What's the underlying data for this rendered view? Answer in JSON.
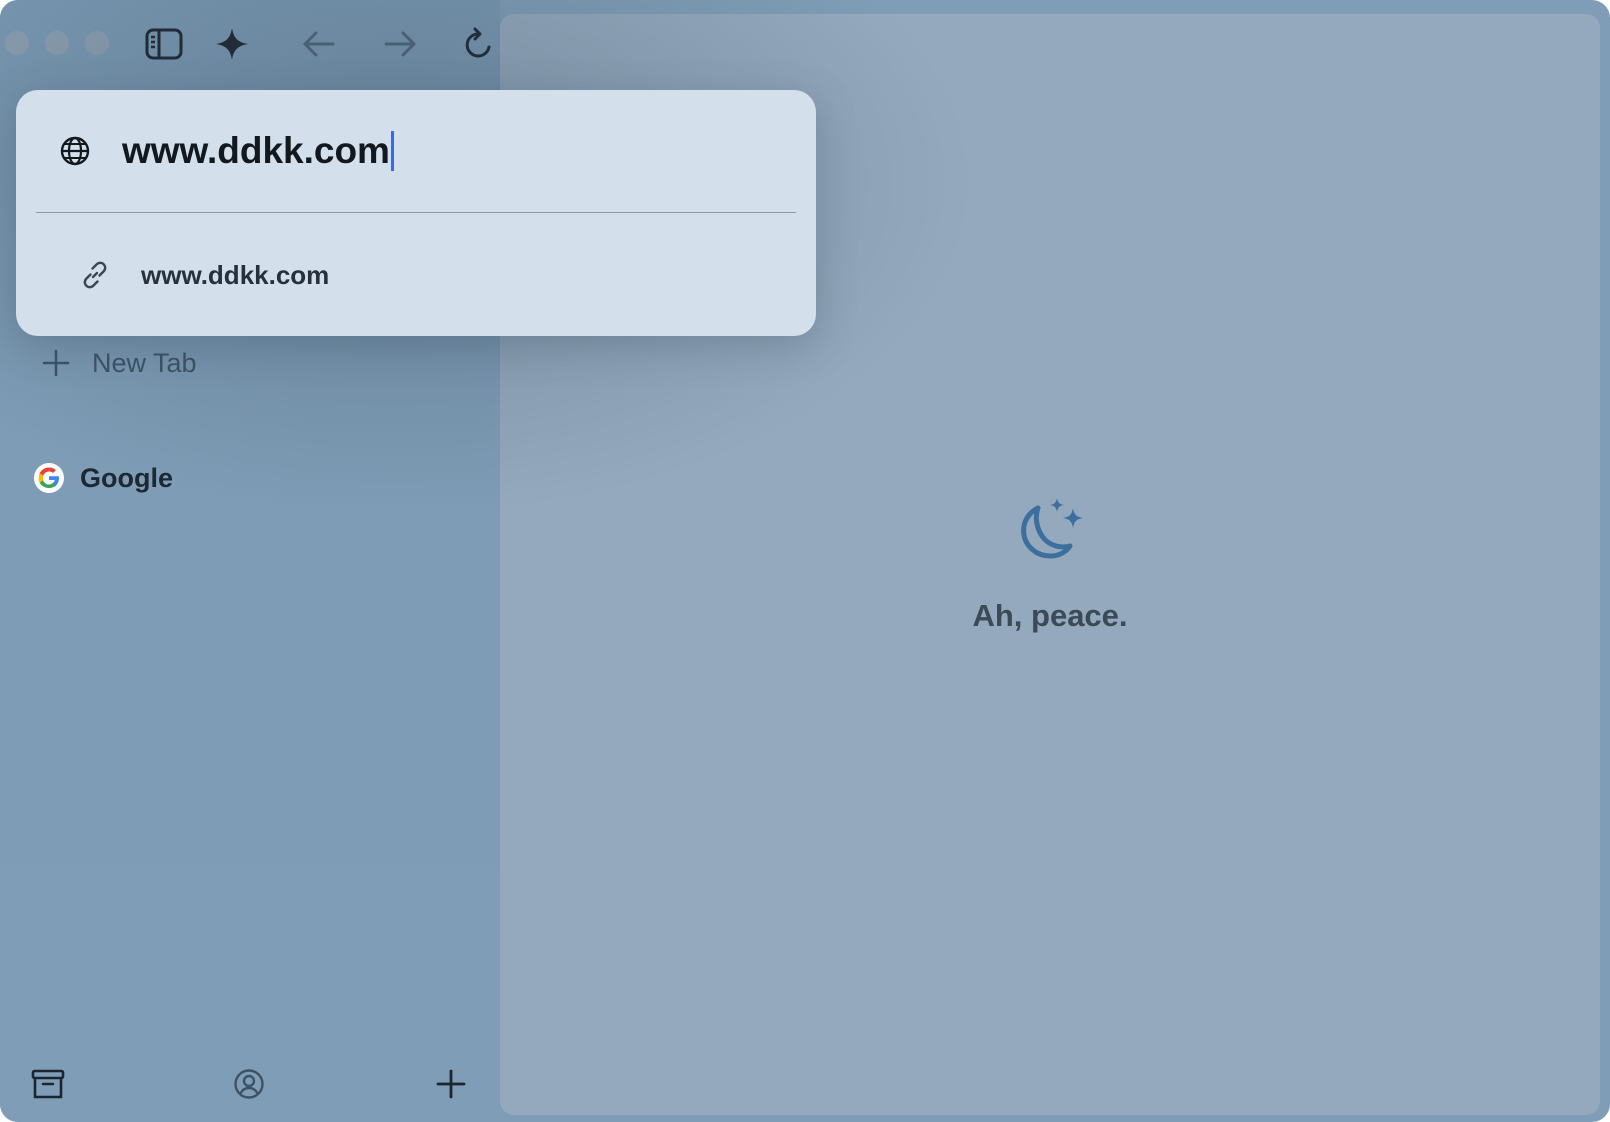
{
  "window": {
    "traffic_lights": [
      "close",
      "minimize",
      "zoom"
    ]
  },
  "toolbar": {
    "icons": [
      "sidebar-toggle-icon",
      "sparkle-icon",
      "back-arrow-icon",
      "forward-arrow-icon",
      "reload-icon"
    ]
  },
  "address_popup": {
    "url_value": "www.ddkk.com",
    "suggestions": [
      {
        "label": "www.ddkk.com",
        "icon": "link-icon"
      }
    ]
  },
  "sidebar": {
    "new_tab_label": "New Tab",
    "tabs": [
      {
        "label": "Google",
        "icon": "google-logo-icon"
      }
    ],
    "bottom_icons": [
      "archive-icon",
      "profile-icon",
      "add-icon"
    ]
  },
  "content": {
    "empty_message": "Ah, peace.",
    "icon": "moon-stars-icon"
  },
  "colors": {
    "sidebar_bg": "#7f9db6",
    "content_bg": "#94a9bd",
    "popup_bg": "#d3dfea",
    "caret": "#2f6df6",
    "moon": "#3d6f9e"
  }
}
